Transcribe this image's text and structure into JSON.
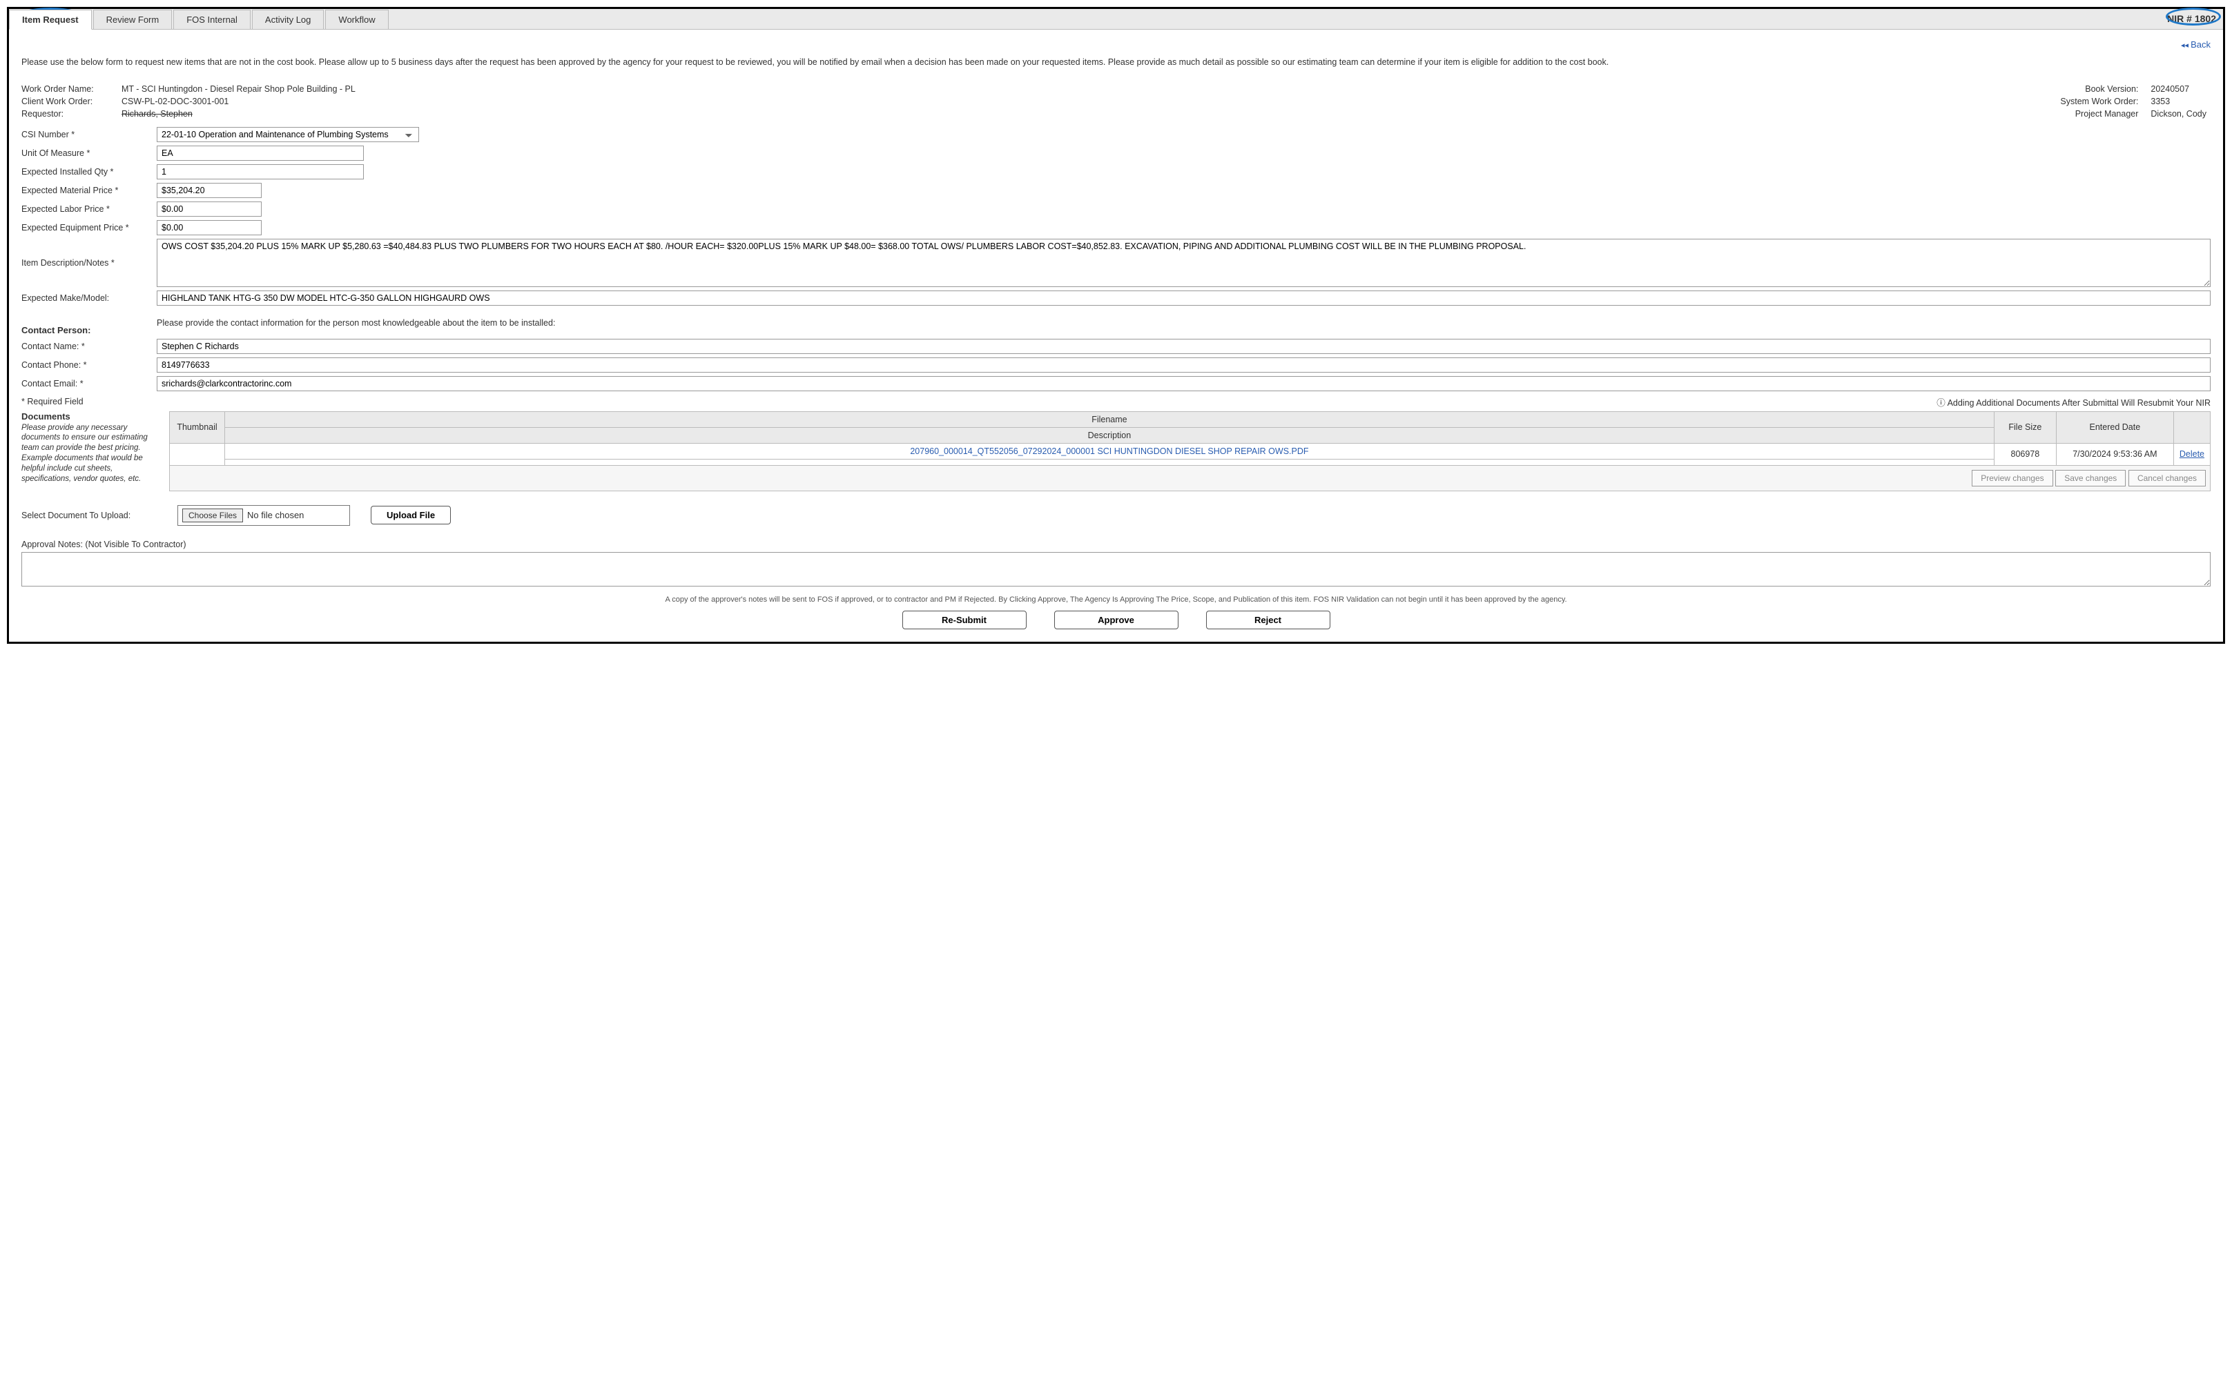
{
  "tabs": {
    "items": [
      "Item Request",
      "Review Form",
      "FOS Internal",
      "Activity Log",
      "Workflow"
    ],
    "active_index": 0
  },
  "nir_number": "NIR # 1802",
  "back_label": "Back",
  "instructions": "Please use the below form to request new items that are not in the cost book.  Please allow up to 5 business days after the request has been approved by the agency for your request to be reviewed, you will be notified by email when a decision has been made on your requested items.  Please provide as much detail as possible so our estimating team can determine if your item is eligible for addition to the cost book.",
  "header_left": {
    "work_order_name_label": "Work Order Name:",
    "work_order_name": "MT - SCI Huntingdon - Diesel Repair Shop Pole Building - PL",
    "client_work_order_label": "Client Work Order:",
    "client_work_order": "CSW-PL-02-DOC-3001-001",
    "requestor_label": "Requestor:",
    "requestor": "Richards, Stephen"
  },
  "header_right": {
    "book_version_label": "Book Version:",
    "book_version": "20240507",
    "system_work_order_label": "System Work Order:",
    "system_work_order": "3353",
    "project_manager_label": "Project Manager",
    "project_manager": "Dickson, Cody"
  },
  "form": {
    "csi_number_label": "CSI Number *",
    "csi_number": "22-01-10   Operation and Maintenance of Plumbing Systems",
    "uom_label": "Unit Of Measure *",
    "uom": "EA",
    "exp_qty_label": "Expected Installed Qty *",
    "exp_qty": "1",
    "exp_material_label": "Expected Material Price *",
    "exp_material": "$35,204.20",
    "exp_labor_label": "Expected Labor Price *",
    "exp_labor": "$0.00",
    "exp_equip_label": "Expected Equipment Price *",
    "exp_equip": "$0.00",
    "item_desc_label": "Item Description/Notes *",
    "item_desc": "OWS COST $35,204.20 PLUS 15% MARK UP $5,280.63 =$40,484.83 PLUS TWO PLUMBERS FOR TWO HOURS EACH AT $80. /HOUR EACH= $320.00PLUS 15% MARK UP $48.00= $368.00 TOTAL OWS/ PLUMBERS LABOR COST=$40,852.83. EXCAVATION, PIPING AND ADDITIONAL PLUMBING COST WILL BE IN THE PLUMBING PROPOSAL.",
    "exp_make_label": "Expected Make/Model:",
    "exp_make": "HIGHLAND TANK HTG-G 350 DW MODEL HTC-G-350 GALLON HIGHGAURD OWS"
  },
  "contact": {
    "section_label": "Contact Person:",
    "instruction": "Please provide the contact information for the person most knowledgeable about the item to be installed:",
    "name_label": "Contact Name: *",
    "name": "Stephen C Richards",
    "phone_label": "Contact Phone: *",
    "phone": "8149776633",
    "email_label": "Contact Email: *",
    "email": "srichards@clarkcontractorinc.com"
  },
  "required_note": "* Required Field",
  "resubmit_note": "Adding Additional Documents After Submittal Will Resubmit Your NIR",
  "documents": {
    "heading": "Documents",
    "desc": "Please provide any necessary documents to ensure our estimating team can provide the best pricing. Example documents that would be helpful include cut sheets, specifications, vendor quotes, etc.",
    "cols": {
      "thumbnail": "Thumbnail",
      "filename": "Filename",
      "description": "Description",
      "filesize": "File Size",
      "entered": "Entered Date"
    },
    "rows": [
      {
        "filename": "207960_000014_QT552056_07292024_000001 SCI HUNTINGDON DIESEL SHOP REPAIR OWS.PDF",
        "description": "",
        "filesize": "806978",
        "entered": "7/30/2024 9:53:36 AM",
        "delete": "Delete"
      }
    ],
    "footer_buttons": {
      "preview": "Preview changes",
      "save": "Save changes",
      "cancel": "Cancel changes"
    }
  },
  "upload": {
    "label": "Select Document To Upload:",
    "choose": "Choose Files",
    "nofile": "No file chosen",
    "upload_btn": "Upload File"
  },
  "approval": {
    "label": "Approval Notes: (Not Visible To Contractor)",
    "value": ""
  },
  "footnote": "A copy of the approver's notes will be sent to FOS if approved, or to contractor and PM if Rejected. By Clicking Approve, The Agency Is Approving The Price, Scope, and Publication of this item. FOS NIR Validation can not begin until it has been approved by the agency.",
  "actions": {
    "resubmit": "Re-Submit",
    "approve": "Approve",
    "reject": "Reject"
  }
}
